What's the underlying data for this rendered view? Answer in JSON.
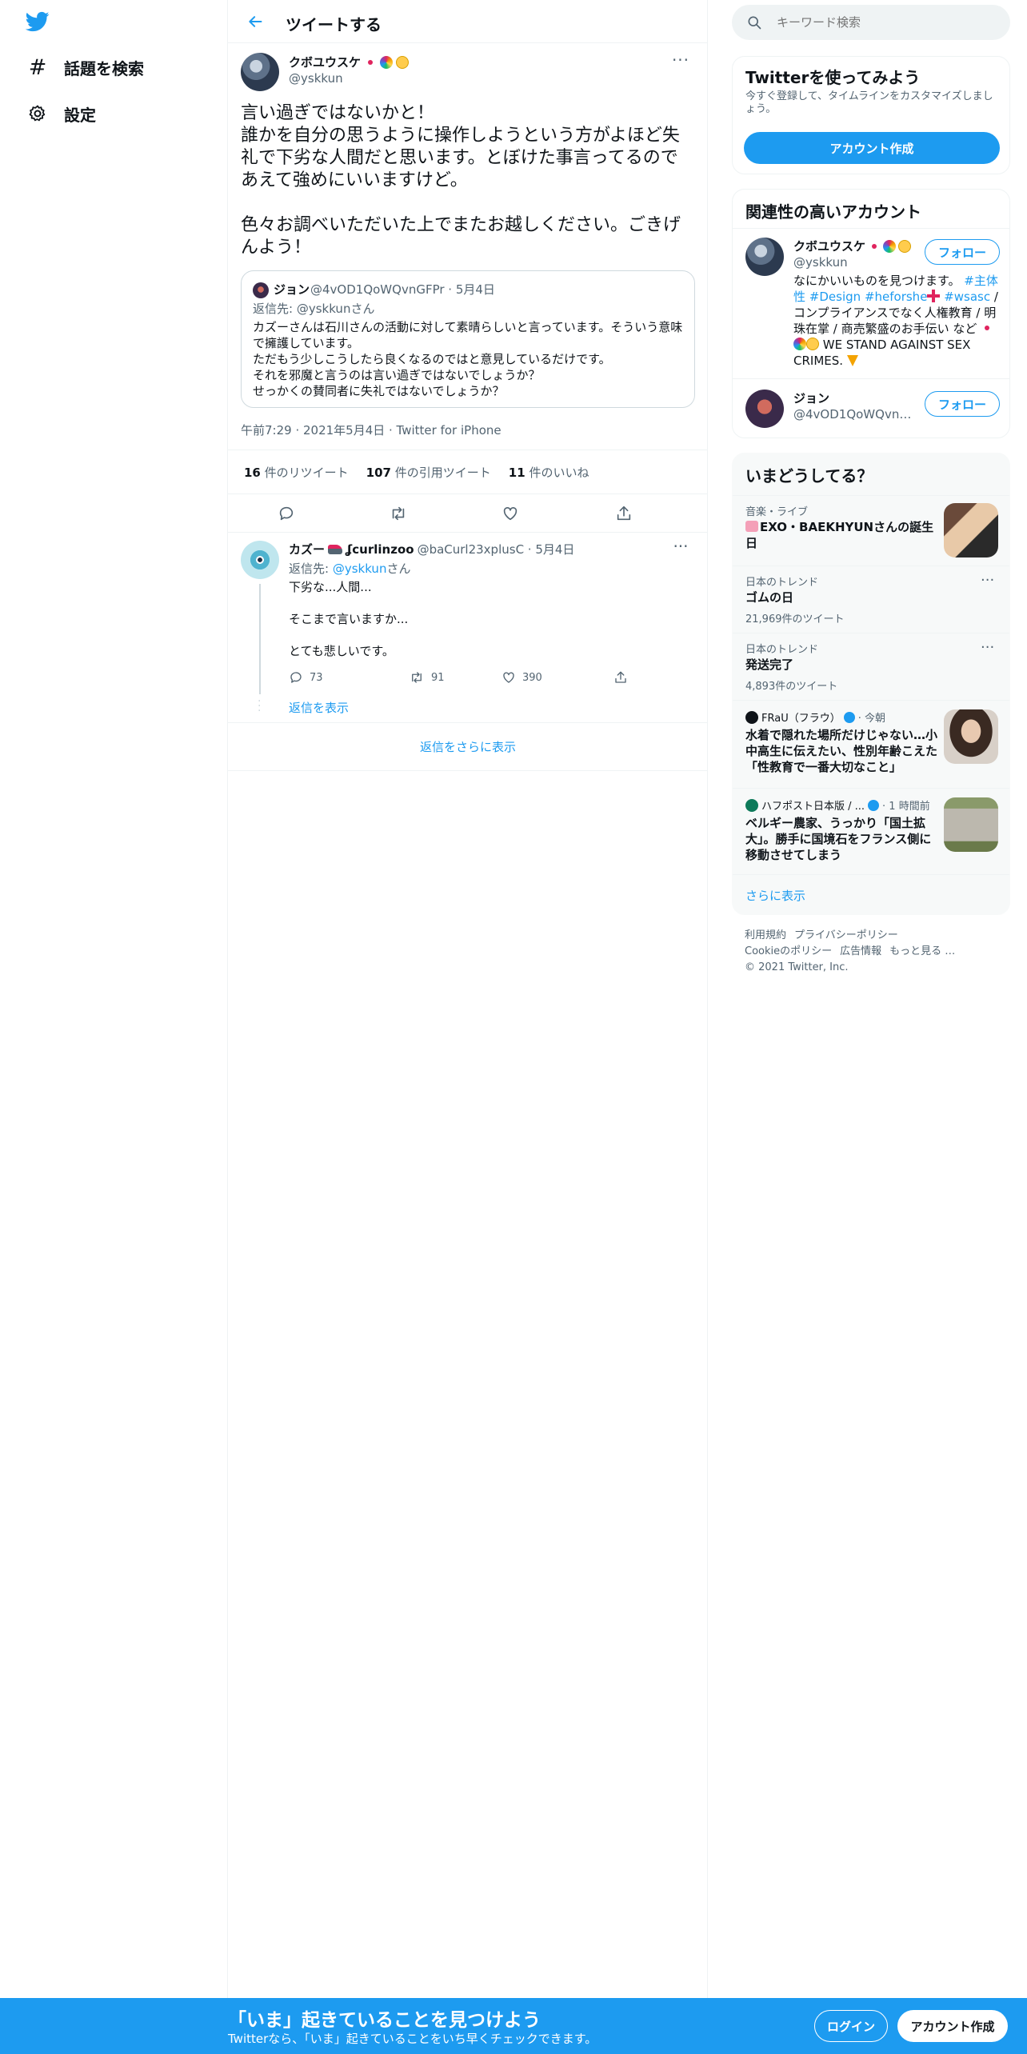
{
  "nav": {
    "explore_label": "話題を検索",
    "settings_label": "設定"
  },
  "header": {
    "title": "ツイートする"
  },
  "tweet": {
    "author_name": "クボユウスケ",
    "author_handle": "@yskkun",
    "text": "言い過ぎではないかと！\n誰かを自分の思うように操作しようという方がよほど失礼で下劣な人間だと思います。とぼけた事言ってるのであえて強めにいいますけど。\n\n色々お調べいただいた上でまたお越しください。ごきげんよう！",
    "quote": {
      "author_name": "ジョン",
      "author_handle": "@4vOD1QoWQvnGFPr · 5月4日",
      "reply_prefix": "返信先: ",
      "reply_to": "@yskkunさん",
      "text": "カズーさんは石川さんの活動に対して素晴らしいと言っています。そういう意味で擁護しています。\nただもう少しこうしたら良くなるのではと意見しているだけです。\nそれを邪魔と言うのは言い過ぎではないでしょうか？\nせっかくの賛同者に失礼ではないでしょうか？"
    },
    "meta": "午前7:29 · 2021年5月4日 · Twitter for iPhone",
    "stats": {
      "retweets_count": "16",
      "retweets_label": "件のリツイート",
      "quotes_count": "107",
      "quotes_label": "件の引用ツイート",
      "likes_count": "11",
      "likes_label": "件のいいね"
    }
  },
  "reply": {
    "author_name": "カズー",
    "author_name2": "ʆcurlinzoo",
    "author_handle": "@baCurl23xplusC · 5月4日",
    "reply_prefix": "返信先: ",
    "reply_to": "@yskkun",
    "reply_suffix": "さん",
    "text": "下劣な...人間...\n\nそこまで言いますか...\n\nとても悲しいです。",
    "reply_count": "73",
    "retweet_count": "91",
    "like_count": "390",
    "show_replies": "返信を表示"
  },
  "more_replies": "返信をさらに表示",
  "search": {
    "placeholder": "キーワード検索"
  },
  "signup_card": {
    "title": "Twitterを使ってみよう",
    "description": "今すぐ登録して、タイムラインをカスタマイズしましょう。",
    "button": "アカウント作成"
  },
  "related": {
    "title": "関連性の高いアカウント",
    "follow_label": "フォロー",
    "accounts": [
      {
        "name": "クボユウスケ",
        "handle": "@yskkun",
        "bio_1": "なにかいいものを見つけます。 ",
        "bio_tag1": "#主体性",
        "bio_tag2": "#Design",
        "bio_tag3": "#heforshe",
        "bio_tag4": "#wsasc",
        "bio_2": " / コンプライアンスでなく人権教育 / 明珠在掌 / 商売繁盛のお手伝い など ",
        "bio_3": " WE STAND AGAINST SEX CRIMES."
      },
      {
        "name": "ジョン",
        "handle": "@4vOD1QoWQvnGFPr"
      }
    ]
  },
  "trends": {
    "title": "いまどうしてる？",
    "items": [
      {
        "context": "音楽・ライブ",
        "title": "EXO・BAEKHYUNさんの誕生日"
      },
      {
        "context": "日本のトレンド",
        "title": "ゴムの日",
        "count": "21,969件のツイート"
      },
      {
        "context": "日本のトレンド",
        "title": "発送完了",
        "count": "4,893件のツイート"
      },
      {
        "source": "FRaU（フラウ）",
        "time": " · 今朝",
        "title": "水着で隠れた場所だけじゃない…小中高生に伝えたい、性別年齢こえた「性教育で一番大切なこと」"
      },
      {
        "source": "ハフポスト日本版 / ...",
        "time": " · 1 時間前",
        "title": "ベルギー農家、うっかり「国土拡大」。勝手に国境石をフランス側に移動させてしまう"
      }
    ],
    "show_more": "さらに表示"
  },
  "footer": {
    "terms": "利用規約",
    "privacy": "プライバシーポリシー",
    "cookies": "Cookieのポリシー",
    "ads": "広告情報",
    "more": "もっと見る …",
    "copyright": "© 2021 Twitter, Inc."
  },
  "banner": {
    "title": "「いま」起きていることを見つけよう",
    "subtitle": "Twitterなら、「いま」起きていることをいち早くチェックできます。",
    "login": "ログイン",
    "signup": "アカウント作成"
  },
  "colors": {
    "accent": "#1d9bf0",
    "text": "#0f1419",
    "muted": "#536471",
    "border": "#eff3f4"
  }
}
